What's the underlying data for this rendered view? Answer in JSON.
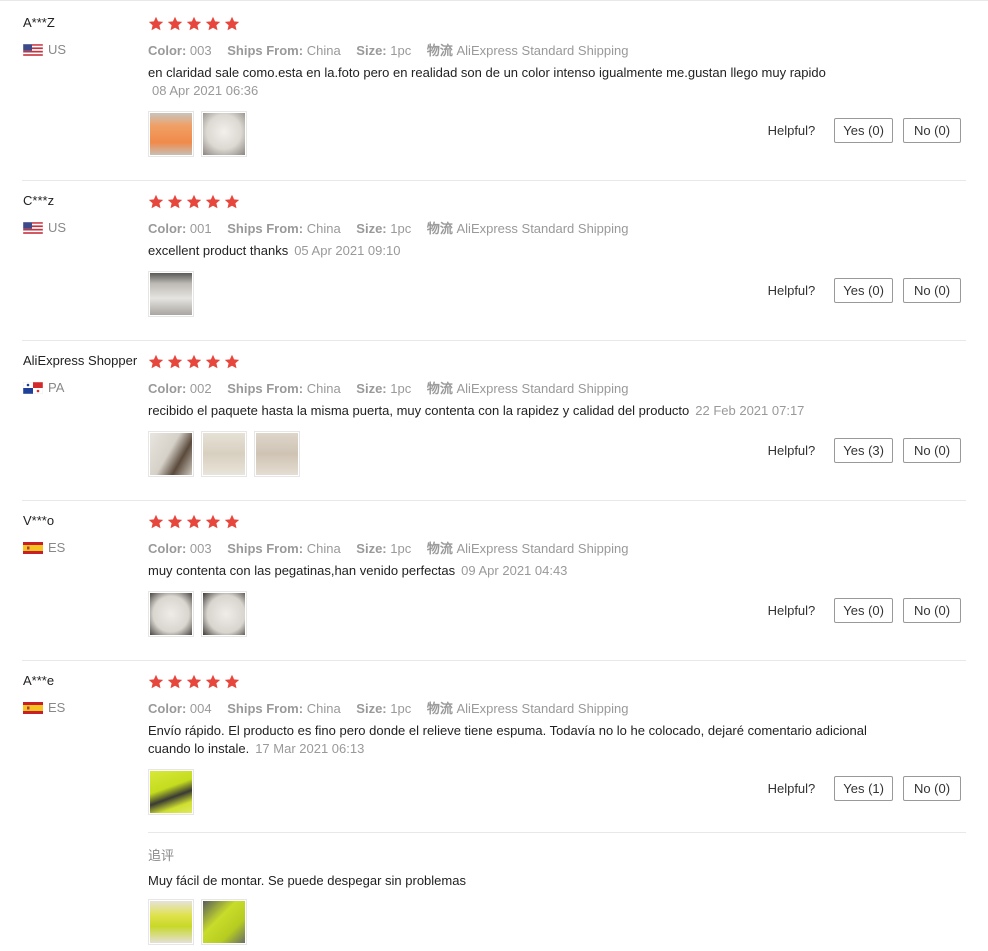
{
  "labels": {
    "color": "Color:",
    "ships_from": "Ships From:",
    "size": "Size:",
    "logistics": "物流",
    "helpful": "Helpful?",
    "followup_title": "追评"
  },
  "colors": {
    "star": "#e6463c",
    "muted": "#999999",
    "border": "#e8e8e8"
  },
  "reviews": [
    {
      "name": "A***Z",
      "country": "US",
      "flag": "us-flag-icon",
      "stars": 5,
      "color": "003",
      "ships_from": "China",
      "size": "1pc",
      "shipping": "AliExpress Standard Shipping",
      "text": "en claridad sale como.esta en la.foto pero en realidad son de un color intenso igualmente me.gustan llego muy rapido",
      "date": "08 Apr 2021 06:36",
      "yes": "Yes (0)",
      "no": "No (0)"
    },
    {
      "name": "C***z",
      "country": "US",
      "flag": "us-flag-icon",
      "stars": 5,
      "color": "001",
      "ships_from": "China",
      "size": "1pc",
      "shipping": "AliExpress Standard Shipping",
      "text": "excellent product thanks",
      "date": "05 Apr 2021 09:10",
      "yes": "Yes (0)",
      "no": "No (0)"
    },
    {
      "name": "AliExpress Shopper",
      "country": "PA",
      "flag": "panama-flag-icon",
      "stars": 5,
      "color": "002",
      "ships_from": "China",
      "size": "1pc",
      "shipping": "AliExpress Standard Shipping",
      "text": "recibido el paquete hasta la misma puerta, muy contenta con la rapidez y calidad del producto",
      "date": "22 Feb 2021 07:17",
      "yes": "Yes (3)",
      "no": "No (0)"
    },
    {
      "name": "V***o",
      "country": "ES",
      "flag": "spain-flag-icon",
      "stars": 5,
      "color": "003",
      "ships_from": "China",
      "size": "1pc",
      "shipping": "AliExpress Standard Shipping",
      "text": "muy contenta con las pegatinas,han venido perfectas",
      "date": "09 Apr 2021 04:43",
      "yes": "Yes (0)",
      "no": "No (0)"
    },
    {
      "name": "A***e",
      "country": "ES",
      "flag": "spain-flag-icon",
      "stars": 5,
      "color": "004",
      "ships_from": "China",
      "size": "1pc",
      "shipping": "AliExpress Standard Shipping",
      "text": "Envío rápido. El producto es fino pero donde el relieve tiene espuma. Todavía no lo he colocado, dejaré comentario adicional cuando lo instale.",
      "date": "17 Mar 2021 06:13",
      "yes": "Yes (1)",
      "no": "No (0)",
      "followup_text": "Muy fácil de montar. Se puede despegar sin problemas"
    }
  ]
}
